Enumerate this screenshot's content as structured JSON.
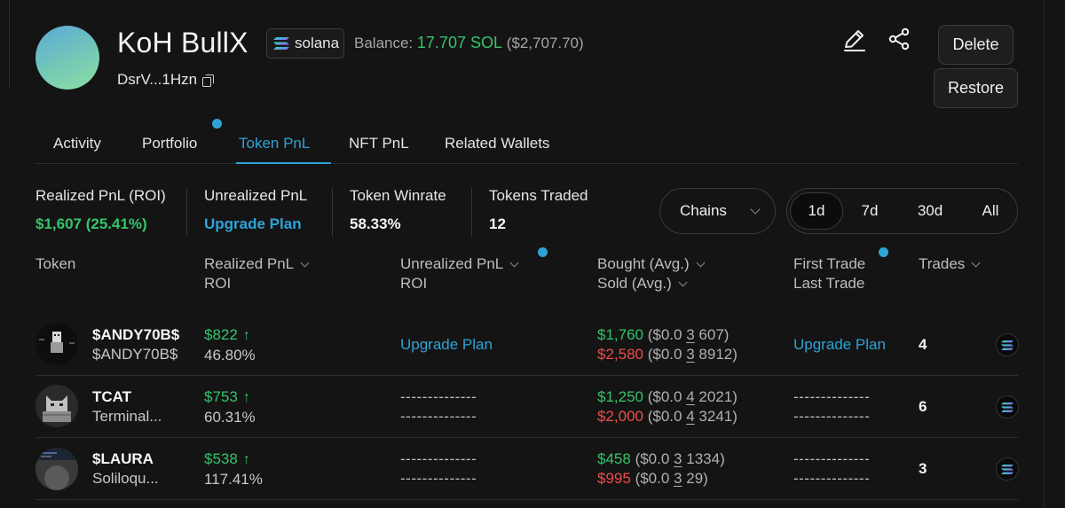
{
  "profile": {
    "name": "KoH BullX",
    "chain_label": "solana",
    "balance_label": "Balance:",
    "balance_sol": "17.707 SOL",
    "balance_usd": "($2,707.70)",
    "address": "DsrV...1Hzn"
  },
  "actions": {
    "delete_label": "Delete",
    "restore_label": "Restore"
  },
  "tabs": [
    {
      "label": "Activity"
    },
    {
      "label": "Portfolio"
    },
    {
      "label": "Token PnL",
      "active": true
    },
    {
      "label": "NFT PnL"
    },
    {
      "label": "Related Wallets"
    }
  ],
  "stats": {
    "realized": {
      "label": "Realized PnL (ROI)",
      "value": "$1,607 (25.41%)"
    },
    "unrealized": {
      "label": "Unrealized PnL",
      "value": "Upgrade Plan"
    },
    "winrate": {
      "label": "Token Winrate",
      "value": "58.33%"
    },
    "traded": {
      "label": "Tokens Traded",
      "value": "12"
    }
  },
  "filters": {
    "chains_label": "Chains",
    "ranges": [
      {
        "label": "1d",
        "active": true
      },
      {
        "label": "7d"
      },
      {
        "label": "30d"
      },
      {
        "label": "All"
      }
    ]
  },
  "columns": {
    "token": "Token",
    "realized_1": "Realized PnL",
    "realized_2": "ROI",
    "unrealized_1": "Unrealized PnL",
    "unrealized_2": "ROI",
    "bought": "Bought (Avg.)",
    "sold": "Sold (Avg.)",
    "first": "First Trade",
    "last": "Last Trade",
    "trades": "Trades"
  },
  "rows": [
    {
      "symbol": "$ANDY70B$",
      "name": "$ANDY70B$",
      "pnl": "$822",
      "roi": "46.80%",
      "unrealized": "Upgrade Plan",
      "unrealized_roi": "",
      "bought": "$1,760",
      "bought_avg_pre": "($0.0",
      "bought_avg_zeros": "3",
      "bought_avg_post": "607)",
      "sold": "$2,580",
      "sold_avg_pre": "($0.0",
      "sold_avg_zeros": "3",
      "sold_avg_post": "8912)",
      "first_trade": "Upgrade Plan",
      "last_trade": "",
      "trades": "4"
    },
    {
      "symbol": "TCAT",
      "name": "Terminal...",
      "pnl": "$753",
      "roi": "60.31%",
      "unrealized": "--------------",
      "unrealized_roi": "--------------",
      "bought": "$1,250",
      "bought_avg_pre": "($0.0",
      "bought_avg_zeros": "4",
      "bought_avg_post": "2021)",
      "sold": "$2,000",
      "sold_avg_pre": "($0.0",
      "sold_avg_zeros": "4",
      "sold_avg_post": "3241)",
      "first_trade": "--------------",
      "last_trade": "--------------",
      "trades": "6"
    },
    {
      "symbol": "$LAURA",
      "name": "Soliloqu...",
      "pnl": "$538",
      "roi": "117.41%",
      "unrealized": "--------------",
      "unrealized_roi": "--------------",
      "bought": "$458",
      "bought_avg_pre": "($0.0",
      "bought_avg_zeros": "3",
      "bought_avg_post": "1334)",
      "sold": "$995",
      "sold_avg_pre": "($0.0",
      "sold_avg_zeros": "3",
      "sold_avg_post": "29)",
      "first_trade": "--------------",
      "last_trade": "--------------",
      "trades": "3"
    }
  ],
  "colors": {
    "accent": "#2ea3d8",
    "gain": "#35c46a",
    "loss": "#ef4d4d",
    "background": "#141414"
  },
  "icons": {
    "edit": "pencil-icon",
    "share": "share-icon",
    "copy": "copy-icon",
    "chain": "solana-icon",
    "sort": "chevron-down-icon"
  }
}
